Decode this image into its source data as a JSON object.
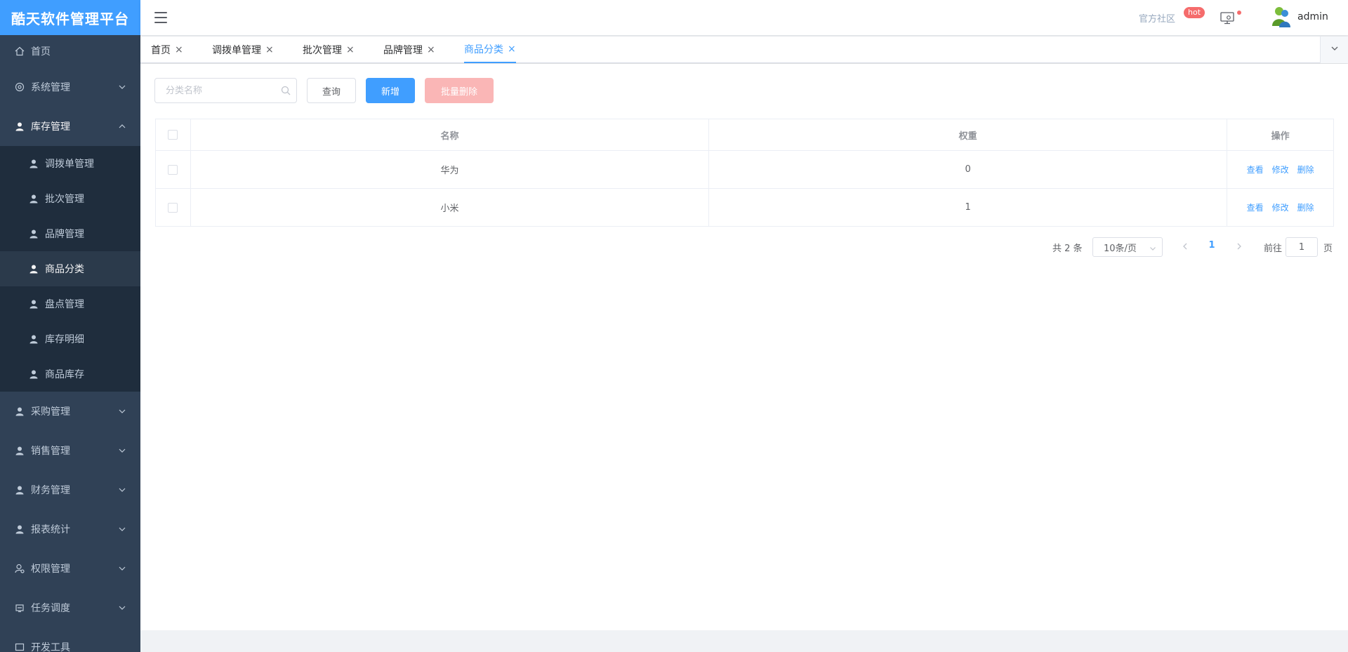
{
  "app": {
    "title": "酷天软件管理平台"
  },
  "sidebar": {
    "items": [
      {
        "label": "首页",
        "icon": "home-icon"
      },
      {
        "label": "系统管理",
        "icon": "gear-icon"
      },
      {
        "label": "库存管理",
        "icon": "user-icon",
        "open": true,
        "children": [
          {
            "label": "调拨单管理"
          },
          {
            "label": "批次管理"
          },
          {
            "label": "品牌管理"
          },
          {
            "label": "商品分类",
            "active": true
          },
          {
            "label": "盘点管理"
          },
          {
            "label": "库存明细"
          },
          {
            "label": "商品库存"
          }
        ]
      },
      {
        "label": "采购管理",
        "icon": "user-icon"
      },
      {
        "label": "销售管理",
        "icon": "user-icon"
      },
      {
        "label": "财务管理",
        "icon": "user-icon"
      },
      {
        "label": "报表统计",
        "icon": "user-icon"
      },
      {
        "label": "权限管理",
        "icon": "user-gear-icon"
      },
      {
        "label": "任务调度",
        "icon": "schedule-icon"
      },
      {
        "label": "开发工具",
        "icon": "tool-icon"
      }
    ]
  },
  "header": {
    "community_label": "官方社区",
    "hot_badge": "hot",
    "username": "admin"
  },
  "tabs": [
    {
      "label": "首页"
    },
    {
      "label": "调拨单管理"
    },
    {
      "label": "批次管理"
    },
    {
      "label": "品牌管理"
    },
    {
      "label": "商品分类",
      "active": true
    }
  ],
  "toolbar": {
    "search_placeholder": "分类名称",
    "query_label": "查询",
    "add_label": "新增",
    "batch_delete_label": "批量删除"
  },
  "table": {
    "columns": [
      "名称",
      "权重",
      "操作"
    ],
    "rows": [
      {
        "name": "华为",
        "weight": "0"
      },
      {
        "name": "小米",
        "weight": "1"
      }
    ],
    "actions": {
      "view": "查看",
      "edit": "修改",
      "delete": "删除"
    }
  },
  "pagination": {
    "total_text": "共 2 条",
    "page_size": "10条/页",
    "current_page": "1",
    "goto_label": "前往",
    "goto_value": "1",
    "page_unit": "页"
  },
  "colors": {
    "sidebar_bg": "#304156",
    "submenu_bg": "#1f2d3d",
    "logo_bg": "#409eff",
    "primary": "#409eff",
    "danger_disabled": "#fab6b6",
    "badge": "#f56c6c"
  }
}
